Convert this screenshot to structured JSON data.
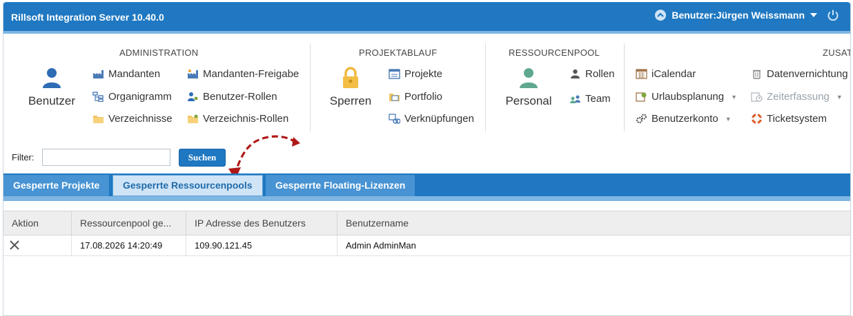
{
  "app": {
    "title": "Rillsoft Integration Server 10.40.0",
    "user_label": "Benutzer:Jürgen Weissmann"
  },
  "ribbon": {
    "administration": {
      "title": "ADMINISTRATION",
      "big_label": "Benutzer",
      "items": [
        "Mandanten",
        "Mandanten-Freigabe",
        "Organigramm",
        "Benutzer-Rollen",
        "Verzeichnisse",
        "Verzeichnis-Rollen"
      ]
    },
    "projektablauf": {
      "title": "PROJEKTABLAUF",
      "big_label": "Sperren",
      "items": [
        "Projekte",
        "Portfolio",
        "Verknüpfungen"
      ]
    },
    "ressourcenpool": {
      "title": "RESSOURCENPOOL",
      "big_label": "Personal",
      "items": [
        "Rollen",
        "Team"
      ]
    },
    "zusatz": {
      "title": "ZUSAT",
      "items": [
        "iCalendar",
        "Datenvernichtung",
        "Urlaubsplanung",
        "Zeiterfassung",
        "Benutzerkonto",
        "Ticketsystem"
      ]
    }
  },
  "filter": {
    "label": "Filter:",
    "value": "",
    "button": "Suchen"
  },
  "tabs": [
    "Gesperrte Projekte",
    "Gesperrte Ressourcenpools",
    "Gesperrte Floating-Lizenzen"
  ],
  "active_tab": "Gesperrte Ressourcenpools",
  "table": {
    "columns": [
      "Aktion",
      "Ressourcenpool ge...",
      "IP Adresse des Benutzers",
      "Benutzername"
    ],
    "rows": [
      {
        "action_icon": "close-icon",
        "date": "17.08.2026 14:20:49",
        "ip": "109.90.121.45",
        "user": "Admin AdminMan"
      }
    ]
  },
  "colors": {
    "primary": "#1f78c1",
    "light_strip": "#7fb6e3",
    "active_tab_bg": "#cfe4f6",
    "annotation_arrow": "#b01818"
  }
}
